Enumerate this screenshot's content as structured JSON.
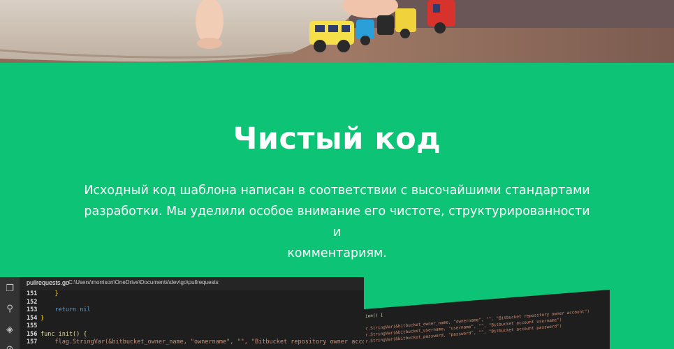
{
  "hero": {
    "image_description": ""
  },
  "section": {
    "title": "Чистый код",
    "description_lines": [
      "Исходный код шаблона написан в соответствии с высочайшими стандартами",
      "разработки. Мы уделили особое внимание его чистоте, структурированности и",
      "комментариям."
    ]
  },
  "editor_left": {
    "tab_file": "pullrequests.go",
    "tab_path": "C:\\Users\\morrison\\OneDrive\\Documents\\dev\\go\\pullrequests",
    "lines": [
      {
        "n": "151",
        "text": "    }"
      },
      {
        "n": "152",
        "text": ""
      },
      {
        "n": "153",
        "text": "    return nil"
      },
      {
        "n": "154",
        "text": "}"
      },
      {
        "n": "155",
        "text": ""
      },
      {
        "n": "156",
        "text": "func init() {"
      },
      {
        "n": "157",
        "text": "    flag.StringVar(&bitbucket_owner_name, \"ownername\", \"\", \"Bitbucket repository owner account\")"
      }
    ]
  },
  "editor_right": {
    "lines": [
      "ion() {",
      "",
      "r.StringVar(&bitbucket_owner_name, \"ownername\", \"\", \"Bitbucket repository owner account\")",
      "r.StringVar(&bitbucket_username, \"username\", \"\", \"Bitbucket account username\")",
      "r.StringVar(&bitbucket_password, \"password\", \"\", \"Bitbucket account password\")"
    ]
  },
  "colors": {
    "brand_green": "#0dc375",
    "editor_bg": "#1e1e1e",
    "activity_bg": "#333333"
  }
}
